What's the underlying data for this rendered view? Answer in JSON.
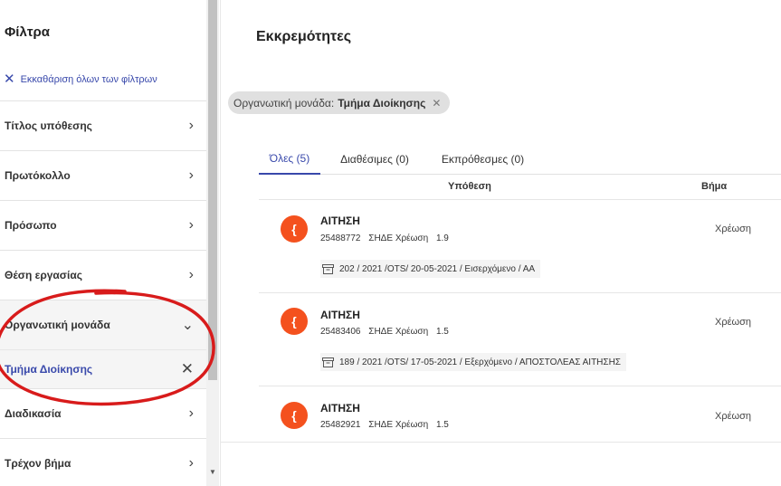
{
  "filters": {
    "title": "Φίλτρα",
    "clear_all": "Εκκαθάριση όλων των φίλτρων",
    "sections": [
      {
        "label": "Τίτλος υπόθεσης"
      },
      {
        "label": "Πρωτόκολλο"
      },
      {
        "label": "Πρόσωπο"
      },
      {
        "label": "Θέση εργασίας"
      },
      {
        "label": "Οργανωτική μονάδα"
      },
      {
        "label": "Διαδικασία"
      },
      {
        "label": "Τρέχον βήμα"
      }
    ],
    "selected_value": "Τμήμα Διοίκησης"
  },
  "main": {
    "title": "Εκκρεμότητες",
    "chip": {
      "key": "Οργανωτική μονάδα:",
      "value": "Τμήμα Διοίκησης"
    },
    "tabs": [
      {
        "label": "Όλες (5)"
      },
      {
        "label": "Διαθέσιμες (0)"
      },
      {
        "label": "Εκπρόθεσμες (0)"
      }
    ],
    "columns": {
      "case": "Υπόθεση",
      "step": "Βήμα"
    },
    "rows": [
      {
        "avatar": "{",
        "title": "ΑΙΤΗΣΗ",
        "id": "25488772",
        "org": "ΣΗΔΕ Χρέωση",
        "version": "1.9",
        "stage": "Χρέωση",
        "tag": "202 / 2021 /OTS/ 20-05-2021 / Εισερχόμενο / ΑΑ"
      },
      {
        "avatar": "{",
        "title": "ΑΙΤΗΣΗ",
        "id": "25483406",
        "org": "ΣΗΔΕ Χρέωση",
        "version": "1.5",
        "stage": "Χρέωση",
        "tag": "189 / 2021 /OTS/ 17-05-2021 / Εξερχόμενο / ΑΠΟΣΤΟΛΕΑΣ ΑΙΤΗΣΗΣ"
      },
      {
        "avatar": "{",
        "title": "ΑΙΤΗΣΗ",
        "id": "25482921",
        "org": "ΣΗΔΕ Χρέωση",
        "version": "1.5",
        "stage": "Χρέωση"
      }
    ]
  },
  "colors": {
    "accent": "#3949ab",
    "avatar": "#f4511e",
    "annotation": "#d81b1b"
  },
  "icons": [
    "close-icon",
    "chevron-right-icon",
    "chevron-down-icon",
    "archive-icon"
  ]
}
